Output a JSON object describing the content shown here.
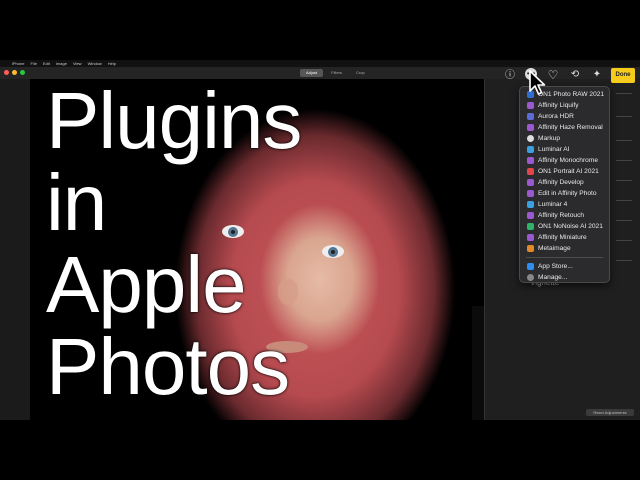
{
  "menubar": {
    "items": [
      "iPhone",
      "File",
      "Edit",
      "Image",
      "View",
      "Window",
      "Help"
    ],
    "right": [
      "",
      "",
      ""
    ]
  },
  "toolbar": {
    "mode_tabs": [
      "Adjust",
      "Filters",
      "Crop"
    ],
    "active_tab": "Adjust",
    "done_label": "Done"
  },
  "overlay": {
    "lines": [
      "Plugins",
      "in",
      "Apple",
      "Photos"
    ]
  },
  "sidebar": {
    "vignette_label": "Vignette",
    "reset_label": "Reset Adjustments"
  },
  "extensions_menu": {
    "items": [
      {
        "label": "ON1 Photo RAW 2021",
        "icon_color": "#2f6fd1"
      },
      {
        "label": "Affinity Liquify",
        "icon_color": "#9b59d0"
      },
      {
        "label": "Aurora HDR",
        "icon_color": "#5b6cd6"
      },
      {
        "label": "Affinity Haze Removal",
        "icon_color": "#9b59d0"
      },
      {
        "label": "Markup",
        "icon_color": "#dddddd"
      },
      {
        "label": "Luminar AI",
        "icon_color": "#3aa0e0"
      },
      {
        "label": "Affinity Monochrome",
        "icon_color": "#9b59d0"
      },
      {
        "label": "ON1 Portrait AI 2021",
        "icon_color": "#e0474c"
      },
      {
        "label": "Affinity Develop",
        "icon_color": "#9b59d0"
      },
      {
        "label": "Edit in Affinity Photo",
        "icon_color": "#9b59d0"
      },
      {
        "label": "Luminar 4",
        "icon_color": "#3aa0e0"
      },
      {
        "label": "Affinity Retouch",
        "icon_color": "#9b59d0"
      },
      {
        "label": "ON1 NoNoise AI 2021",
        "icon_color": "#2fb36a"
      },
      {
        "label": "Affinity Miniature",
        "icon_color": "#9b59d0"
      },
      {
        "label": "Metaimage",
        "icon_color": "#e08a2a"
      }
    ],
    "footer": [
      {
        "label": "App Store...",
        "icon_color": "#2f8cf0"
      },
      {
        "label": "Manage...",
        "icon_color": "#888888"
      }
    ]
  },
  "colors": {
    "done_button": "#f5cc1b",
    "menu_bg": "#2b2b2d"
  }
}
